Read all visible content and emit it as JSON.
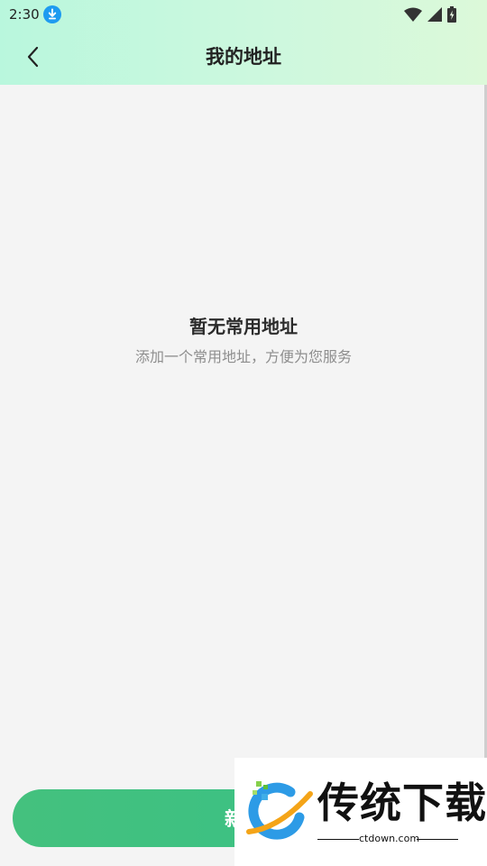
{
  "status_bar": {
    "time": "2:30",
    "icons": [
      "download-icon",
      "wifi-icon",
      "signal-icon",
      "battery-icon"
    ]
  },
  "nav": {
    "back_icon": "chevron-left-icon",
    "title": "我的地址"
  },
  "empty_state": {
    "title": "暂无常用地址",
    "subtitle": "添加一个常用地址，方便为您服务"
  },
  "add_button": {
    "label": "新增"
  },
  "watermark": {
    "brand": "传统下载",
    "domain": "ctdown.com"
  },
  "colors": {
    "header_gradient_start": "#b9f7dd",
    "header_gradient_end": "#dcf9d9",
    "background": "#f4f4f4",
    "button": "#3cc183",
    "download_badge": "#1e9bf0"
  }
}
